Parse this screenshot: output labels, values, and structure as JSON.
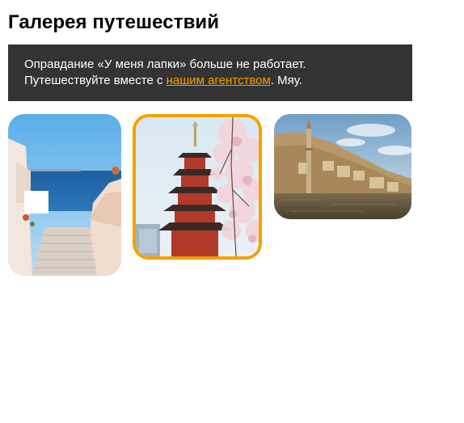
{
  "page": {
    "title": "Галерея путешествий"
  },
  "banner": {
    "line1": "Оправдание «У меня лапки» больше не работает.",
    "line2_prefix": "Путешествуйте вместе с ",
    "link_text": "нашим агентством",
    "line2_suffix": ". Мяу."
  },
  "gallery": {
    "images": [
      {
        "subject": "santorini-stairs-sea",
        "selected": false
      },
      {
        "subject": "pagoda-cherry-blossom",
        "selected": true
      },
      {
        "subject": "minaret-riverside-town",
        "selected": false
      }
    ]
  },
  "colors": {
    "banner_bg": "#333333",
    "accent": "#f5a000",
    "text": "#000000"
  }
}
